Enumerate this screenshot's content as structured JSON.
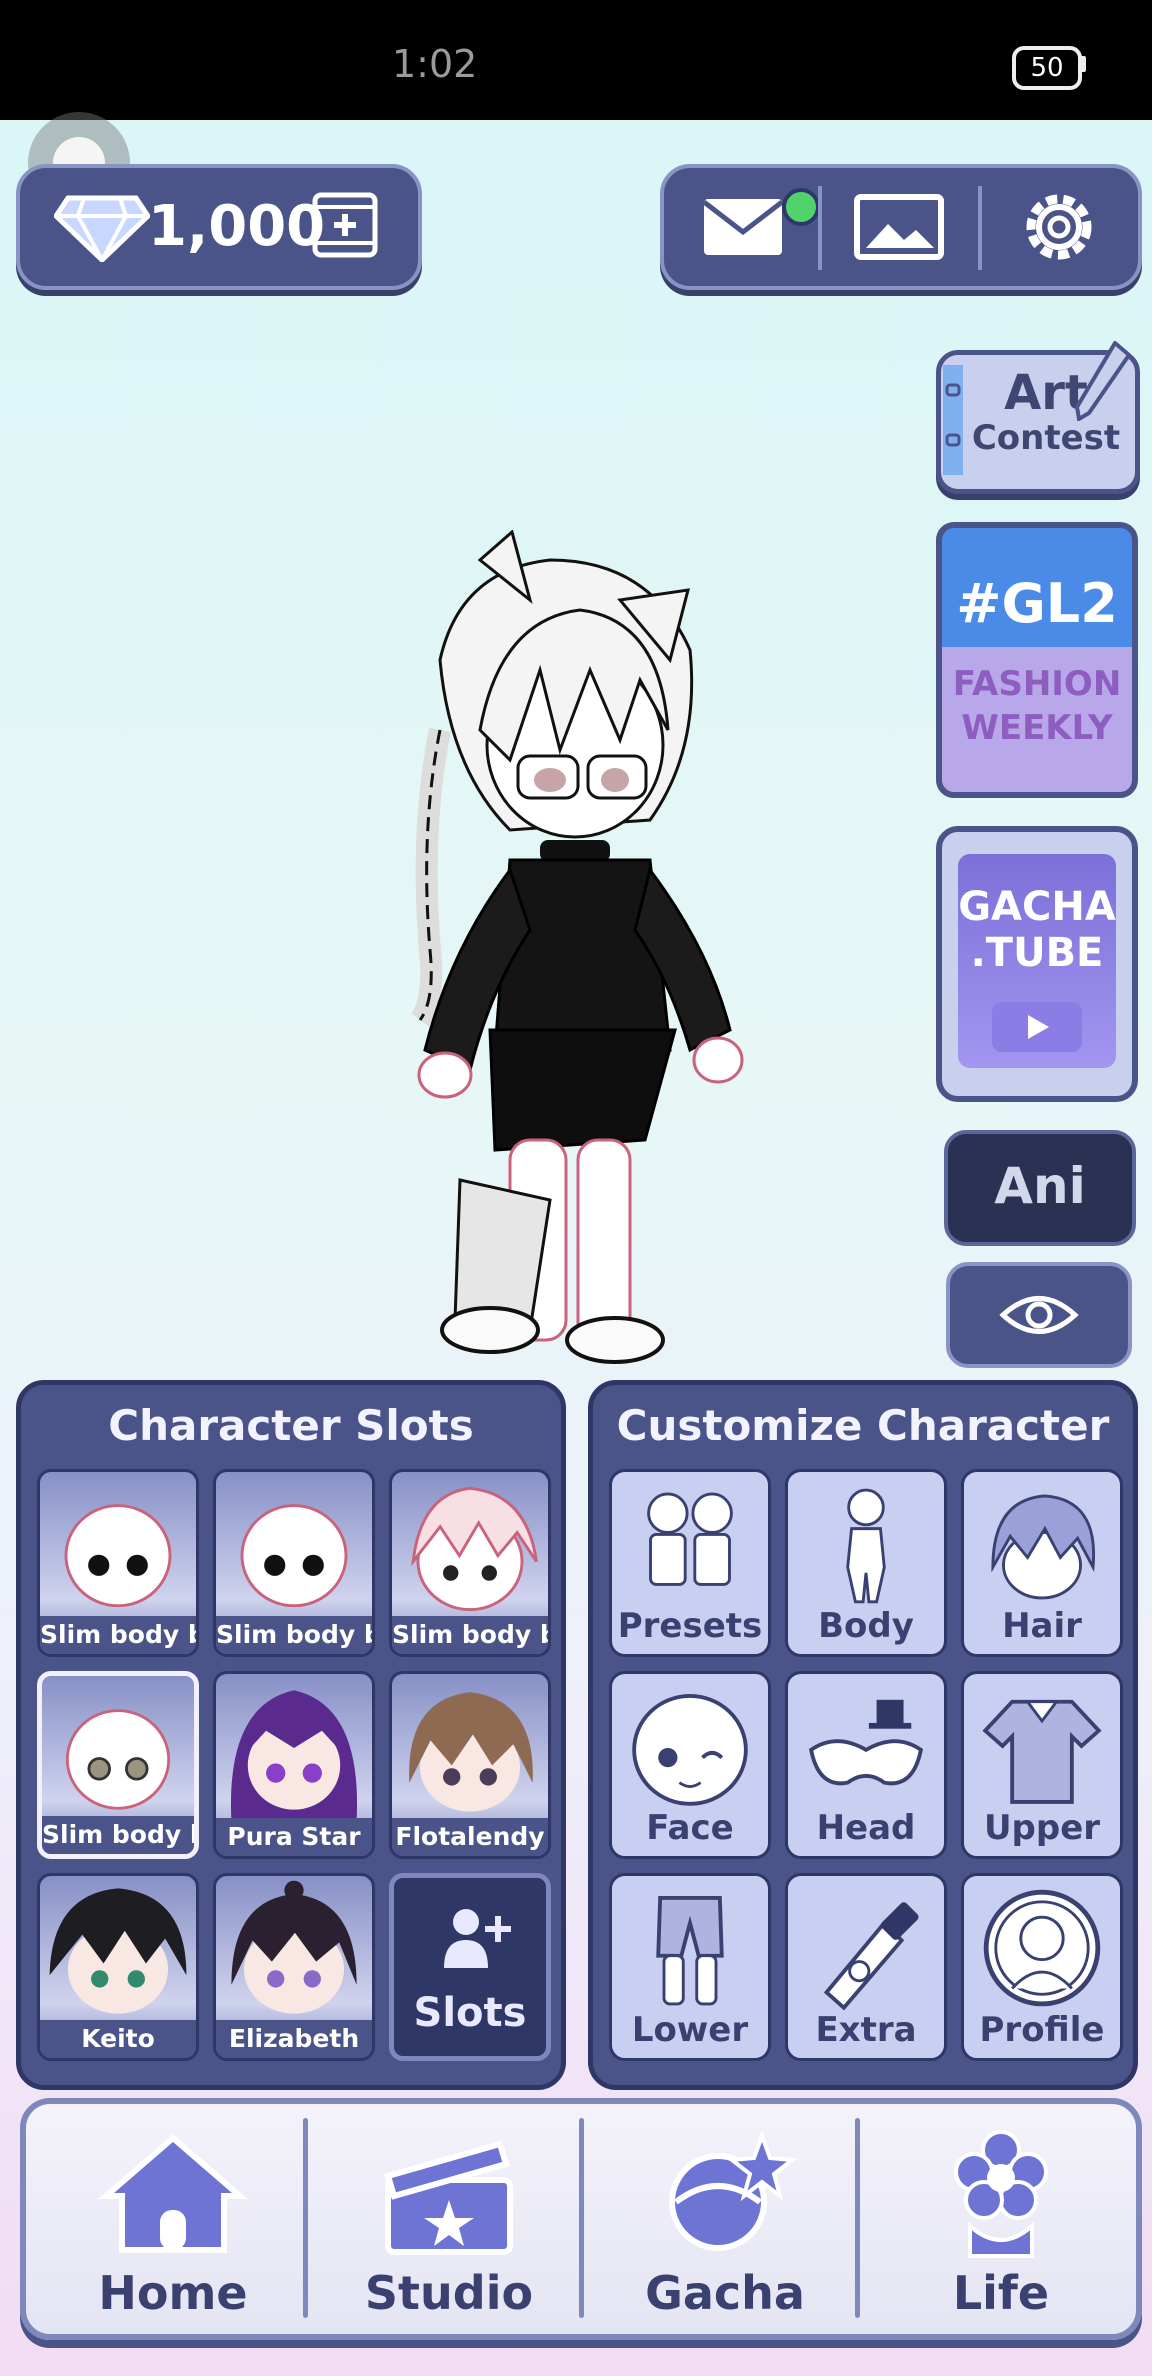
{
  "status_bar": {
    "time": "1:02",
    "battery": "50"
  },
  "header": {
    "currency_value": "1,000",
    "buttons": [
      {
        "name": "mail-icon",
        "has_notification": true
      },
      {
        "name": "gallery-icon"
      },
      {
        "name": "gear-icon"
      }
    ]
  },
  "side_menu": {
    "art_contest": {
      "line1": "Art",
      "line2": "Contest"
    },
    "fashion": {
      "tag": "#GL2",
      "line1": "FASHION",
      "line2": "WEEKLY"
    },
    "tube": {
      "line1": "GACHA",
      "line2": ".TUBE"
    },
    "ani_label": "Ani"
  },
  "character_slots": {
    "title": "Character Slots",
    "slots": [
      {
        "label": "Slim body bas",
        "hair": "none"
      },
      {
        "label": "Slim body bas",
        "hair": "none"
      },
      {
        "label": "Slim body bas",
        "hair": "white"
      },
      {
        "label": "Slim body bas",
        "hair": "none",
        "selected": true
      },
      {
        "label": "Pura Star",
        "hair": "purple"
      },
      {
        "label": "Flotalendy",
        "hair": "brown"
      },
      {
        "label": "Keito",
        "hair": "black"
      },
      {
        "label": "Elizabeth",
        "hair": "black"
      }
    ],
    "add_label": "Slots"
  },
  "customize": {
    "title": "Customize Character",
    "items": [
      {
        "label": "Presets",
        "icon": "presets-icon"
      },
      {
        "label": "Body",
        "icon": "body-icon"
      },
      {
        "label": "Hair",
        "icon": "hair-icon"
      },
      {
        "label": "Face",
        "icon": "face-icon"
      },
      {
        "label": "Head",
        "icon": "head-icon"
      },
      {
        "label": "Upper",
        "icon": "upper-icon"
      },
      {
        "label": "Lower",
        "icon": "lower-icon"
      },
      {
        "label": "Extra",
        "icon": "extra-icon"
      },
      {
        "label": "Profile",
        "icon": "profile-icon"
      }
    ]
  },
  "bottom_nav": [
    {
      "label": "Home",
      "icon": "home-icon"
    },
    {
      "label": "Studio",
      "icon": "clapperboard-icon"
    },
    {
      "label": "Gacha",
      "icon": "gacha-icon"
    },
    {
      "label": "Life",
      "icon": "flower-icon"
    }
  ]
}
